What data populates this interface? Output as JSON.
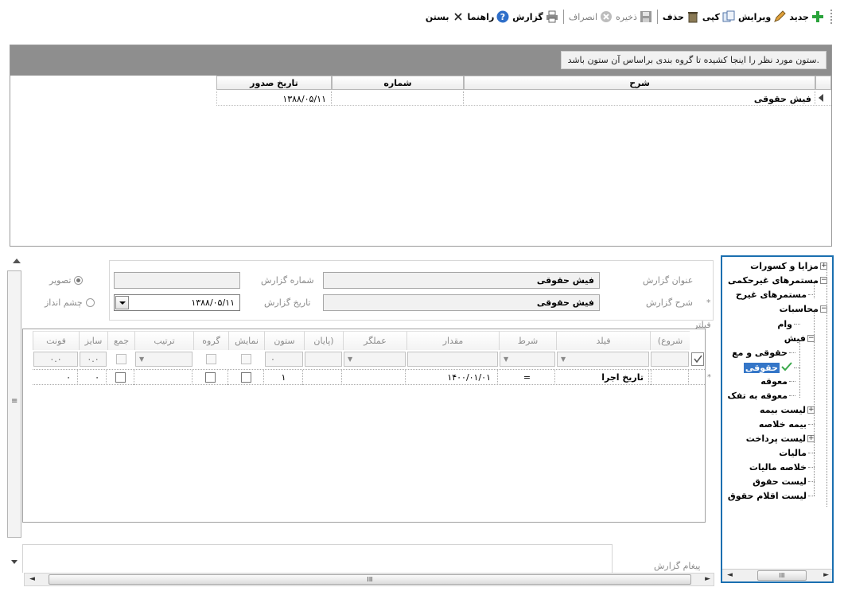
{
  "toolbar": {
    "new": "جدید",
    "edit": "ویرایش",
    "copy": "کپی",
    "delete": "حذف",
    "save": "ذخیره",
    "cancel": "انصراف",
    "report": "گزارش",
    "help": "راهنما",
    "close": "بستن"
  },
  "top_grid": {
    "group_hint": "ستون مورد نظر را اینجا کشیده تا گروه بندی براساس آن ستون باشد.",
    "columns": [
      "شرح",
      "شماره",
      "تاریخ صدور"
    ],
    "rows": [
      {
        "description": "فیش حقوقی",
        "number": "",
        "issue_date": "۱۳۸۸/۰۵/۱۱"
      }
    ]
  },
  "tree": {
    "items": [
      {
        "label": "مزایا و کسورات",
        "expander": "+"
      },
      {
        "label": "مستمرهای غیرحکمی",
        "expander": "-"
      },
      {
        "label": "مستمرهای غیرح"
      },
      {
        "label": "محاسبات",
        "expander": "-"
      },
      {
        "label": "وام"
      },
      {
        "label": "فیش",
        "expander": "-"
      },
      {
        "label": "حقوقی و مع"
      },
      {
        "label": "حقوقی"
      },
      {
        "label": "معوقه"
      },
      {
        "label": "معوقه به تفک"
      },
      {
        "label": "لیست بیمه",
        "expander": "+"
      },
      {
        "label": "بیمه خلاصه"
      },
      {
        "label": "لیست پرداخت",
        "expander": "+"
      },
      {
        "label": "مالیات"
      },
      {
        "label": "خلاصه مالیات"
      },
      {
        "label": "لیست حقوق"
      },
      {
        "label": "لیست اقلام حقوق"
      }
    ],
    "scroll_grip": "III"
  },
  "form": {
    "title_label": "عنوان گزارش",
    "title_value": "فیش حقوقی",
    "number_label": "شماره گزارش",
    "number_value": "",
    "desc_label": "شرح گزارش",
    "desc_value": "فیش حقوقی",
    "date_label": "تاریخ گزارش",
    "date_value": "۱۳۸۸/۰۵/۱۱",
    "radio_image": "تصویر",
    "radio_landscape": "چشم انداز",
    "filter_label": "فیلتر",
    "message_label": "پیغام گزارش"
  },
  "filter_grid": {
    "headers": [
      "(شروع",
      "فیلد",
      "شرط",
      "مقدار",
      "عملگر",
      "پایان)",
      "ستون",
      "نمایش",
      "گروه",
      "ترتیب",
      "جمع",
      "سایز",
      "فونت"
    ],
    "filter_row": {
      "column": "۰",
      "size": "۰.۰",
      "font": "۰.۰"
    },
    "row": {
      "field": "تاریخ اجرا",
      "condition": "=",
      "value": "۱۴۰۰/۰۱/۰۱",
      "column": "۱",
      "size": "۰",
      "font": "۰"
    }
  },
  "bottom_scroll_grip": "III",
  "colors": {
    "accent": "#1a6fb0",
    "selection": "#3476c8",
    "group_bar": "#8e8e8e"
  }
}
